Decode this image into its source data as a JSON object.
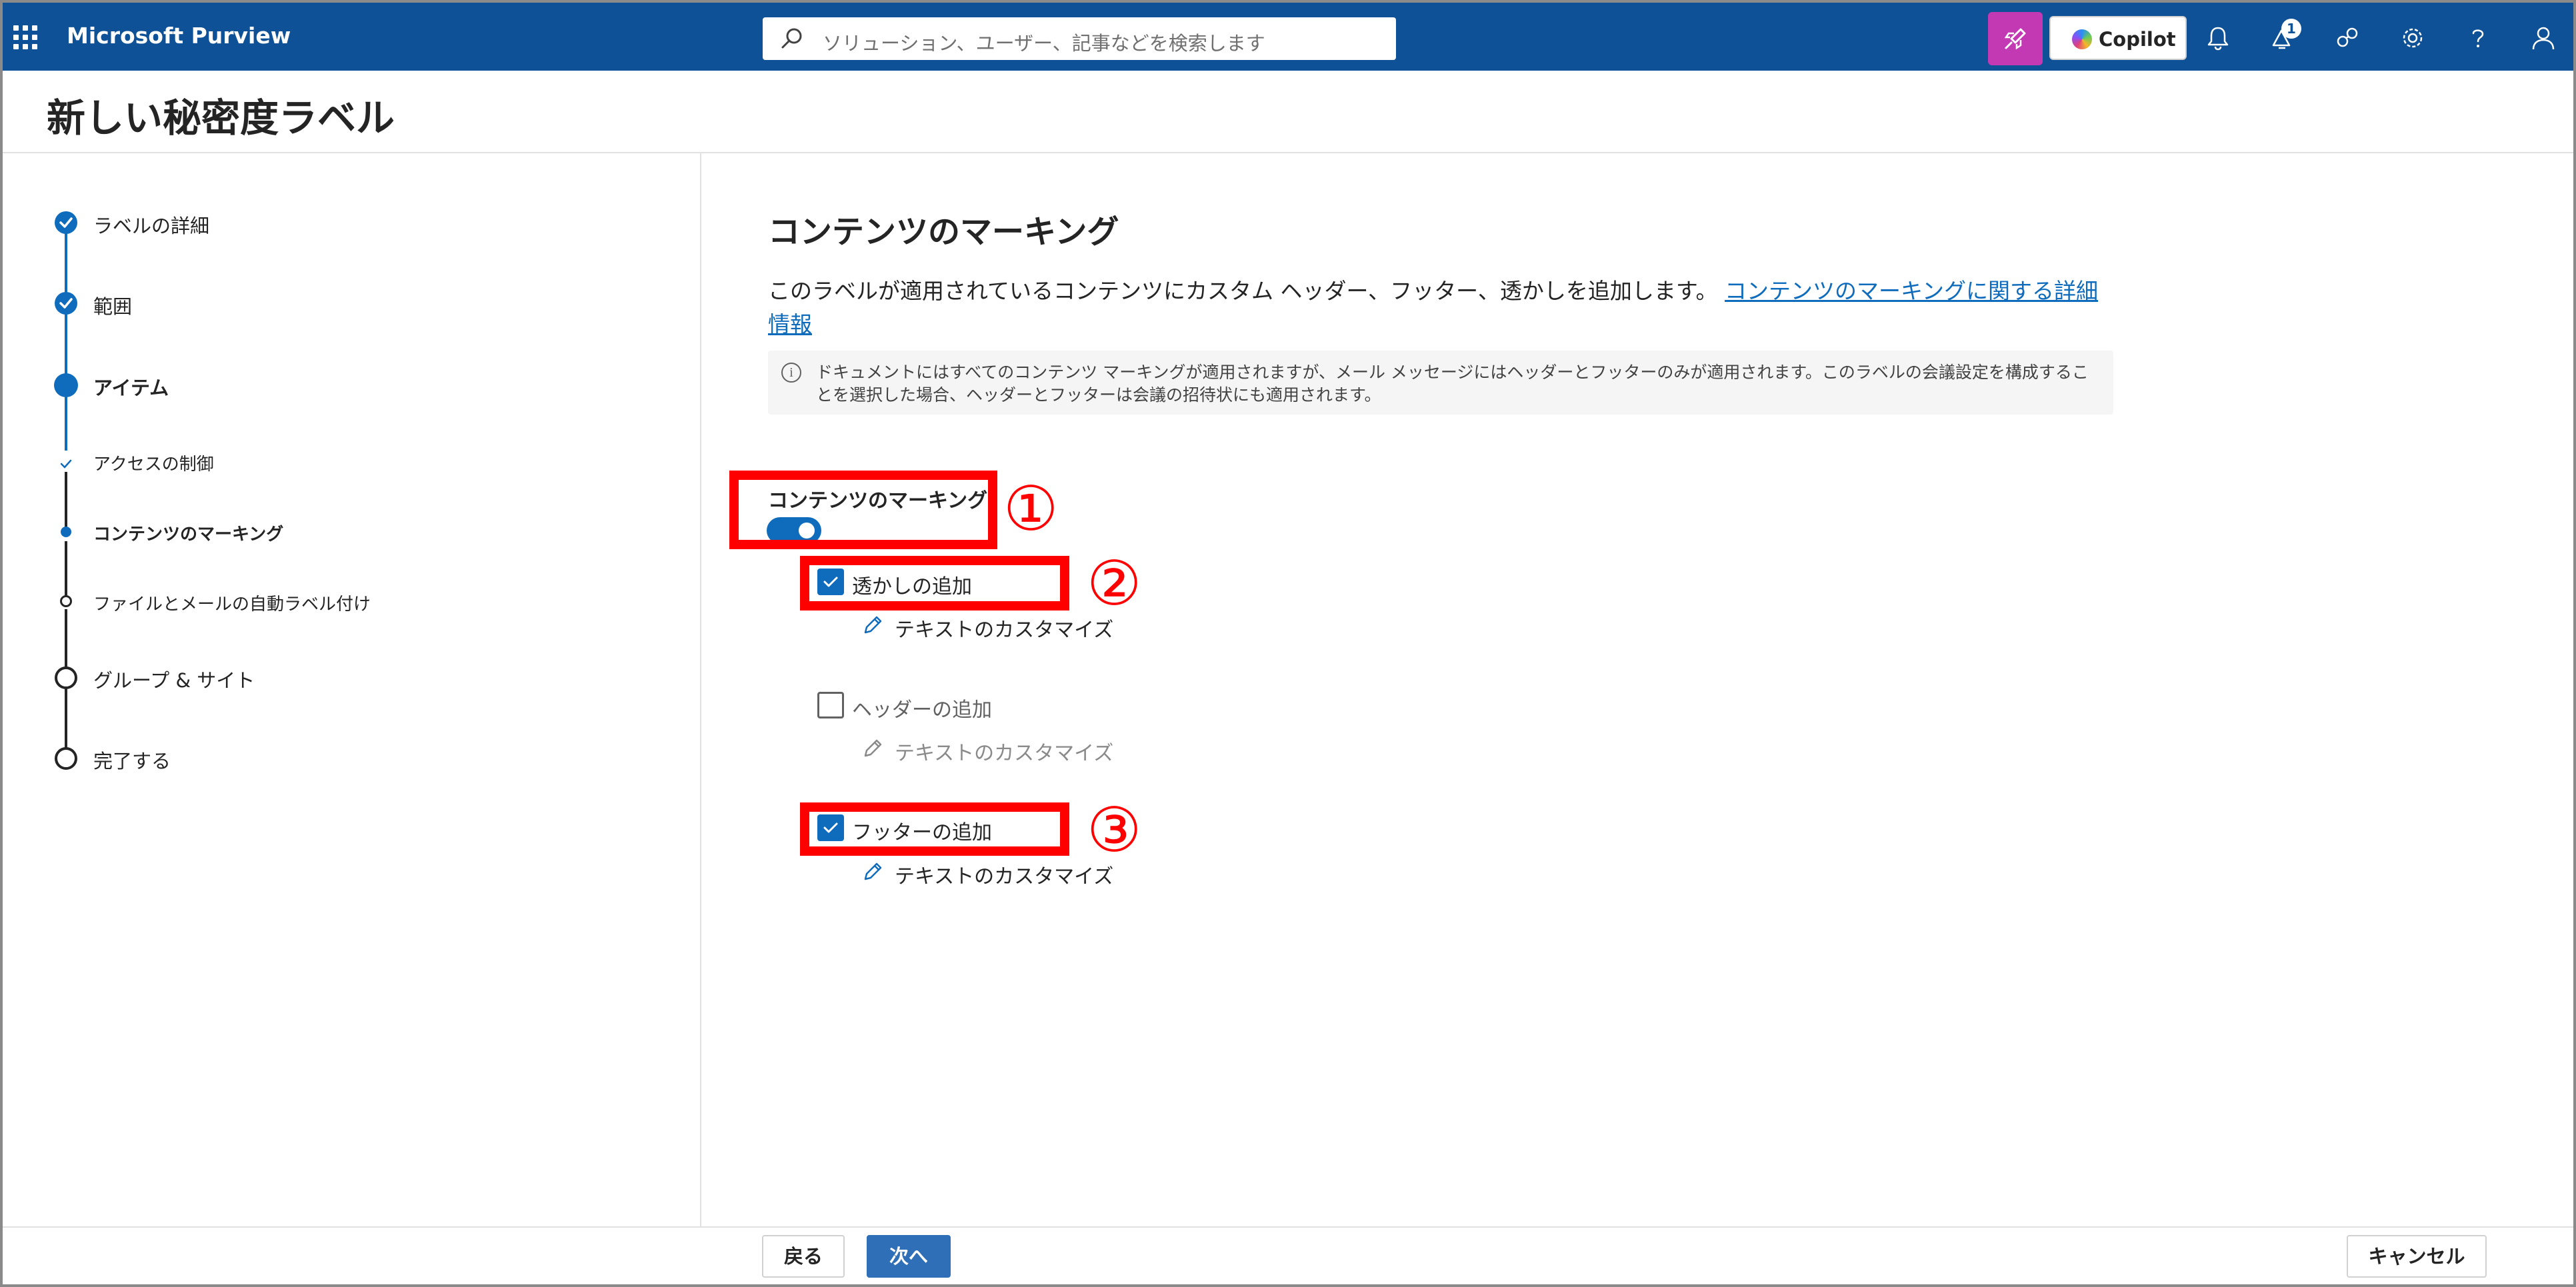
{
  "app": {
    "name": "Microsoft Purview"
  },
  "search": {
    "placeholder": "ソリューション、ユーザー、記事などを検索します"
  },
  "topbar": {
    "copilot_label": "Copilot",
    "notification_count": "1"
  },
  "page": {
    "title": "新しい秘密度ラベル"
  },
  "stepper": {
    "steps": [
      {
        "label": "ラベルの詳細",
        "state": "completed"
      },
      {
        "label": "範囲",
        "state": "completed"
      },
      {
        "label": "アイテム",
        "state": "current"
      },
      {
        "label": "アクセスの制御",
        "state": "completed-sub"
      },
      {
        "label": "コンテンツのマーキング",
        "state": "current-sub"
      },
      {
        "label": "ファイルとメールの自動ラベル付け",
        "state": "pending-sub"
      },
      {
        "label": "グループ & サイト",
        "state": "pending"
      },
      {
        "label": "完了する",
        "state": "pending"
      }
    ]
  },
  "content": {
    "section_title": "コンテンツのマーキング",
    "description": "このラベルが適用されているコンテンツにカスタム ヘッダー、フッター、透かしを追加します。",
    "learn_more_link": "コンテンツのマーキングに関する詳細情報",
    "info_text": "ドキュメントにはすべてのコンテンツ マーキングが適用されますが、メール メッセージにはヘッダーとフッターのみが適用されます。このラベルの会議設定を構成することを選択した場合、ヘッダーとフッターは会議の招待状にも適用されます。",
    "marking_toggle_label": "コンテンツのマーキング",
    "marking_toggle_on": true,
    "options": [
      {
        "label": "透かしの追加",
        "checked": true,
        "customize_label": "テキストのカスタマイズ"
      },
      {
        "label": "ヘッダーの追加",
        "checked": false,
        "customize_label": "テキストのカスタマイズ"
      },
      {
        "label": "フッターの追加",
        "checked": true,
        "customize_label": "テキストのカスタマイズ"
      }
    ]
  },
  "annotations": {
    "num1": "①",
    "num2": "②",
    "num3": "③",
    "color": "#ff0000"
  },
  "footer": {
    "back_label": "戻る",
    "next_label": "次へ",
    "cancel_label": "キャンセル"
  },
  "colors": {
    "brand": "#0f5196",
    "accent": "#0f6cbd",
    "copilot_accent": "#c239b3"
  }
}
